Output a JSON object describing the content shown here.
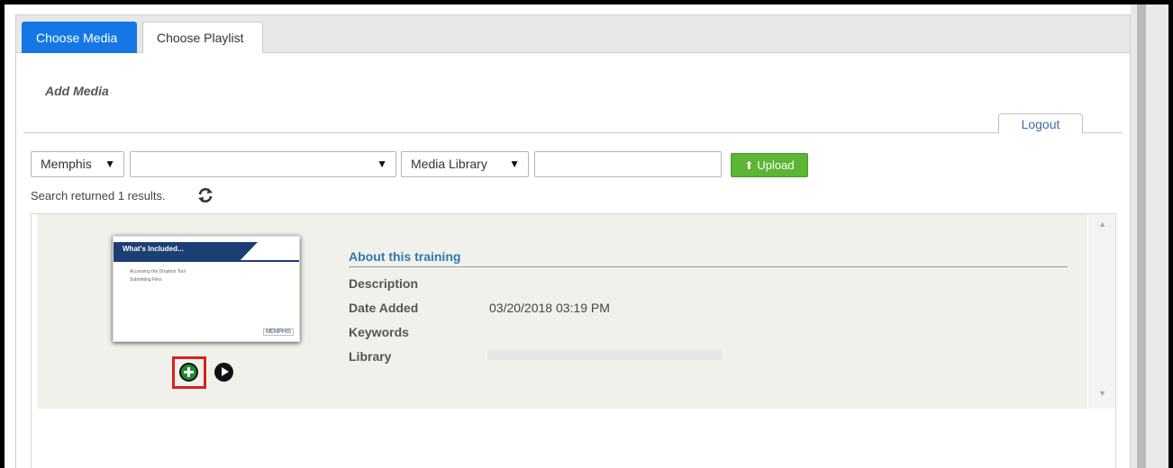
{
  "tabs": [
    {
      "label": "Choose Media",
      "active": true
    },
    {
      "label": "Choose Playlist",
      "active": false
    }
  ],
  "section_title": "Add Media",
  "logout_label": "Logout",
  "filters": {
    "location_value": "Memphis",
    "category_value": "",
    "source_value": "Media Library",
    "search_value": "",
    "upload_label": "Upload"
  },
  "results_text": "Search returned 1 results.",
  "media_item": {
    "thumbnail": {
      "title": "What's Included...",
      "line1": "Accessing the Dropbox Tool",
      "line2": "Submitting Files",
      "logo": "MEMPHIS"
    },
    "title": "About this training",
    "fields": [
      {
        "label": "Description",
        "value": ""
      },
      {
        "label": "Date Added",
        "value": "03/20/2018 03:19 PM"
      },
      {
        "label": "Keywords",
        "value": ""
      },
      {
        "label": "Library",
        "value": ""
      }
    ]
  },
  "colors": {
    "active_tab": "#1577e6",
    "upload_button": "#5cb535",
    "link_title": "#2f78b4",
    "highlight_box": "#d9221c",
    "add_icon": "#1f8a2b"
  },
  "icons": {
    "refresh": "refresh-icon",
    "upload": "upload-icon",
    "add": "add-circle-icon",
    "play": "play-circle-icon"
  }
}
